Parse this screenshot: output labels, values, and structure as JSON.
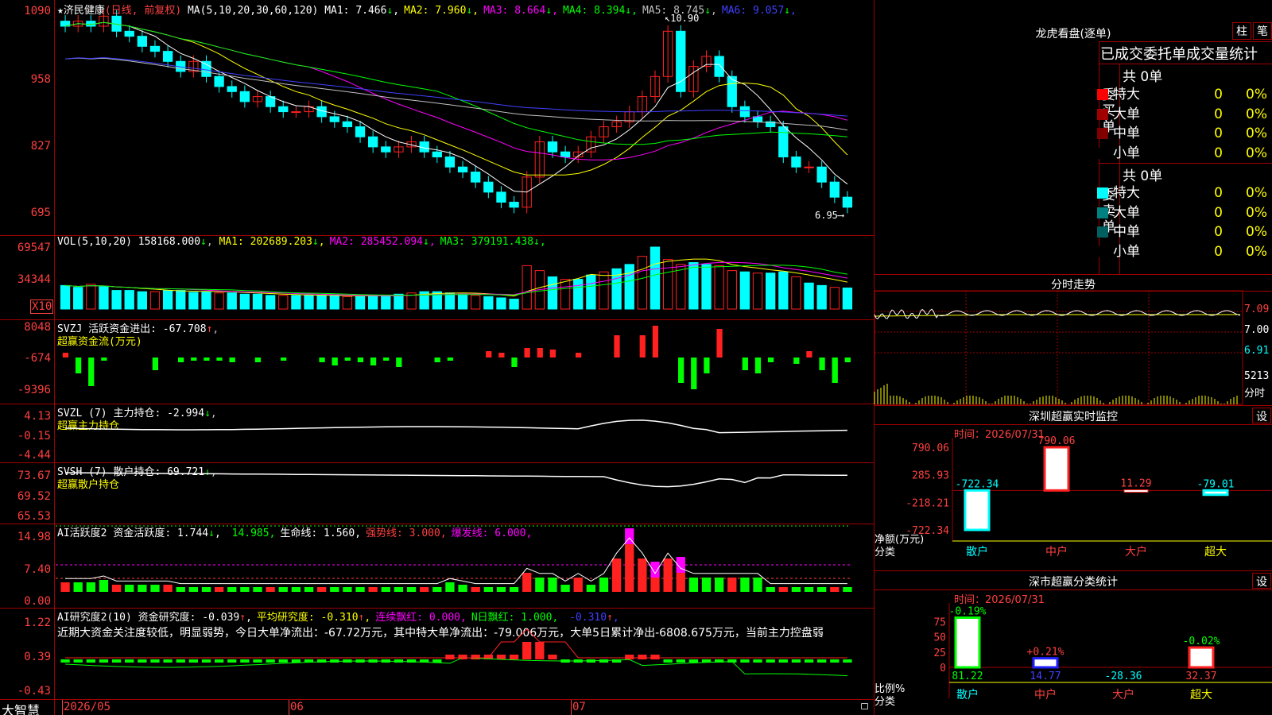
{
  "main": {
    "y_ticks": [
      "1090",
      "958",
      "827",
      "695"
    ],
    "star": "★",
    "stock_name": "济民健康",
    "period": "(日线, 前复权)",
    "ma_label": "MA(5,10,20,30,60,120)",
    "ma": [
      {
        "label": "MA1:",
        "value": "7.466",
        "arrow": "↓",
        "color": "#ffffff"
      },
      {
        "label": "MA2:",
        "value": "7.960",
        "arrow": "↓",
        "color": "#ffff00"
      },
      {
        "label": "MA3:",
        "value": "8.664",
        "arrow": "↓",
        "color": "#ff00ff"
      },
      {
        "label": "MA4:",
        "value": "8.394",
        "arrow": "↓",
        "color": "#00ff00"
      },
      {
        "label": "MA5:",
        "value": "8.745",
        "arrow": "↓",
        "color": "#c0c0c0"
      },
      {
        "label": "MA6:",
        "value": "9.057",
        "arrow": "↓",
        "color": "#4040ff"
      }
    ],
    "high_marker": "10.90",
    "low_marker": "6.95",
    "colors": {
      "up": "#ff2020",
      "down": "#00ffff",
      "ma1": "#ffffff",
      "ma2": "#ffff00",
      "ma3": "#ff00ff",
      "ma4": "#00ff00",
      "ma5": "#c0c0c0",
      "ma6": "#4040ff"
    }
  },
  "volume": {
    "y_ticks": [
      "69547",
      "34344"
    ],
    "multiplier": "X10",
    "label": "VOL(5,10,20)",
    "value": "158168.000",
    "value_arrow": "↓",
    "ma": [
      {
        "label": "MA1:",
        "value": "202689.203",
        "arrow": "↓",
        "color": "#ffff00"
      },
      {
        "label": "MA2:",
        "value": "285452.094",
        "arrow": "↓",
        "color": "#ff00ff"
      },
      {
        "label": "MA3:",
        "value": "379191.438",
        "arrow": "↓",
        "color": "#00ff00"
      }
    ]
  },
  "svzj": {
    "y_ticks": [
      "8048",
      "-674",
      "-9396"
    ],
    "name": "SVZJ",
    "desc": "活跃资金进出:",
    "value": "-67.708",
    "arrow": "↑",
    "sub": "超赢资金流(万元)"
  },
  "svzl": {
    "y_ticks": [
      "4.13",
      "-0.15",
      "-4.44"
    ],
    "name": "SVZL (7)",
    "desc": "主力持仓:",
    "value": "-2.994",
    "arrow": "↓",
    "sub": "超赢主力持仓"
  },
  "svsh": {
    "y_ticks": [
      "73.67",
      "69.52",
      "65.53"
    ],
    "name": "SVSH (7)",
    "desc": "散户持仓:",
    "value": "69.721",
    "arrow": "↓",
    "sub": "超赢散户持仓"
  },
  "ai_active": {
    "y_ticks": [
      "14.98",
      "7.40",
      "0.00"
    ],
    "name": "AI活跃度2",
    "items": [
      {
        "label": "资金活跃度:",
        "value": "1.744",
        "arrow": "↓",
        "color": "#ffffff"
      },
      {
        "label": "",
        "value": "14.985",
        "arrow": "",
        "color": "#00ff00"
      },
      {
        "label": "生命线:",
        "value": "1.560",
        "arrow": "",
        "color": "#ffffff"
      },
      {
        "label": "强势线:",
        "value": "3.000",
        "arrow": "",
        "color": "#ff4040"
      },
      {
        "label": "爆发线:",
        "value": "6.000",
        "arrow": "",
        "color": "#ff00ff"
      }
    ]
  },
  "ai_research": {
    "y_ticks": [
      "1.22",
      "0.39",
      "-0.43"
    ],
    "name": "AI研究度2(10)",
    "items": [
      {
        "label": "资金研究度:",
        "value": "-0.039",
        "arrow": "↑",
        "color": "#ffffff"
      },
      {
        "label": "平均研究度:",
        "value": "-0.310",
        "arrow": "↑",
        "color": "#ffff00"
      },
      {
        "label": "连续飘红:",
        "value": "0.000",
        "arrow": "",
        "color": "#ff00ff"
      },
      {
        "label": "N日飘红:",
        "value": "1.000",
        "arrow": "",
        "color": "#00ff00"
      },
      {
        "label": "",
        "value": "-0.310",
        "arrow": "↑",
        "color": "#4040ff"
      }
    ],
    "summary": "近期大资金关注度较低，明显弱势，今日大单净流出：-67.72万元，其中特大单净流出：-79.006万元，大单5日累计净出-6808.675万元，当前主力控盘弱"
  },
  "bottom_bar": {
    "brand": "大智慧",
    "dates": [
      "2026/05",
      "06",
      "07"
    ]
  },
  "right": {
    "longhu": {
      "title": "龙虎看盘(逐单)",
      "btn_zhu": "柱",
      "btn_bi": "笔",
      "tabs_text": "已成交委托单成交量统计",
      "buy": {
        "side_label": "委买单",
        "total": "共 0单",
        "rows": [
          {
            "name": "特大",
            "count": "0",
            "pct": "0%",
            "color": "#ff0000"
          },
          {
            "name": "大单",
            "count": "0",
            "pct": "0%",
            "color": "#a00000"
          },
          {
            "name": "中单",
            "count": "0",
            "pct": "0%",
            "color": "#800000"
          },
          {
            "name": "小单",
            "count": "0",
            "pct": "0%",
            "color": "#000000"
          }
        ]
      },
      "sell": {
        "side_label": "委卖单",
        "total": "共 0单",
        "rows": [
          {
            "name": "特大",
            "count": "0",
            "pct": "0%",
            "color": "#00ffff"
          },
          {
            "name": "大单",
            "count": "0",
            "pct": "0%",
            "color": "#008080"
          },
          {
            "name": "中单",
            "count": "0",
            "pct": "0%",
            "color": "#006060"
          },
          {
            "name": "小单",
            "count": "0",
            "pct": "0%",
            "color": "#000000"
          }
        ]
      }
    },
    "intraday": {
      "title": "分时走势",
      "y_ticks": [
        "7.09",
        "7.00",
        "6.91"
      ],
      "vol_tick": "5213",
      "vol_label": "分时"
    },
    "sz_monitor": {
      "title": "深圳超赢实时监控",
      "btn": "设",
      "time_label": "时间：2026/07/31",
      "y_ticks": [
        "790.06",
        "285.93",
        "-218.21",
        "-722.34"
      ],
      "y_unit": "净额(万元)",
      "x_title": "分类",
      "categories": [
        "散户",
        "中户",
        "大户",
        "超大"
      ],
      "values": [
        -722.34,
        790.06,
        11.29,
        -79.01
      ],
      "value_labels": [
        "-722.34",
        "790.06",
        "11.29",
        "-79.01"
      ]
    },
    "sz_stats": {
      "title": "深市超赢分类统计",
      "btn": "设",
      "time_label": "时间：2026/07/31",
      "y_ticks": [
        "75",
        "50",
        "25",
        "0"
      ],
      "y_unit": "比例%",
      "x_title": "分类",
      "categories": [
        "散户",
        "中户",
        "大户",
        "超大"
      ],
      "bar_pct": [
        81.22,
        14.77,
        0,
        32.37
      ],
      "top_labels": [
        "-0.19%",
        "+0.21%",
        "",
        "-0.02%"
      ],
      "bottom_labels": [
        "81.22",
        "14.77",
        "-28.36",
        "32.37"
      ]
    }
  }
}
